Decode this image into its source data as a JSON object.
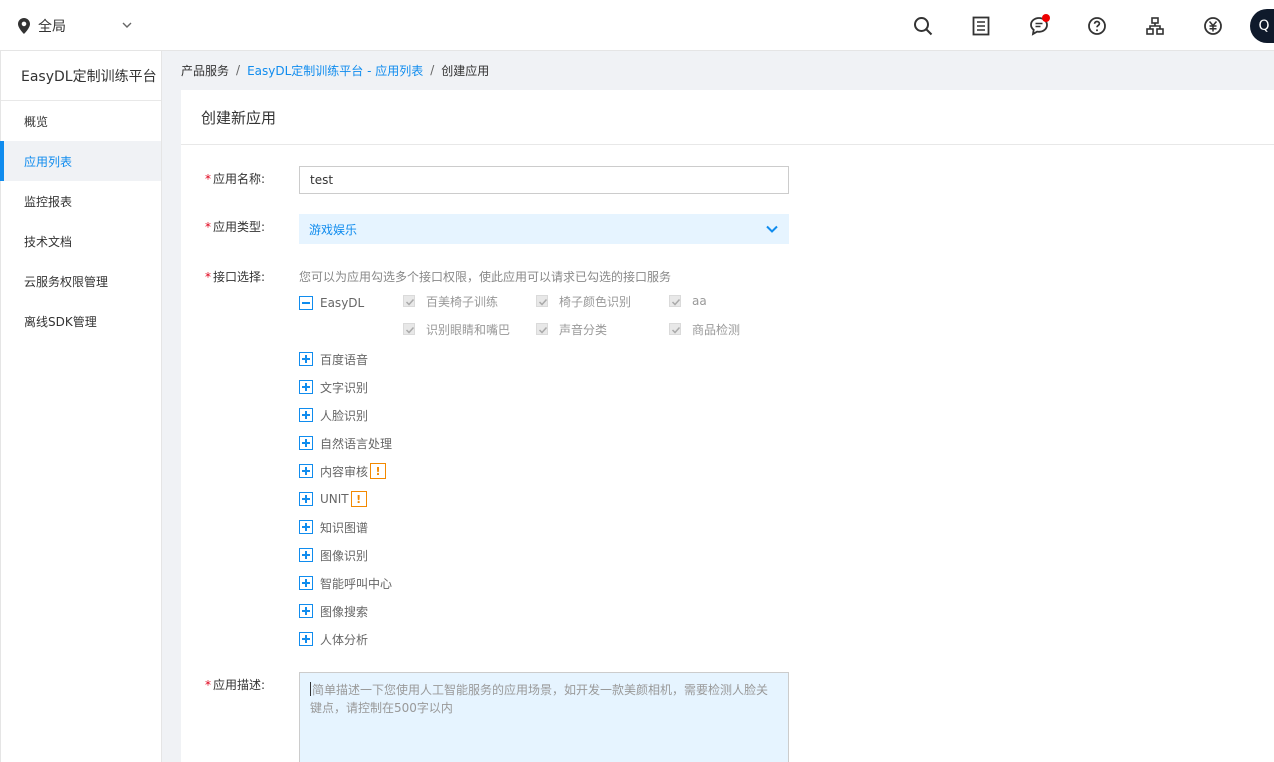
{
  "topbar": {
    "region_label": "全局",
    "avatar_letter": "Q"
  },
  "sidebar": {
    "brand": "EasyDL定制训练平台",
    "items": [
      {
        "label": "概览"
      },
      {
        "label": "应用列表"
      },
      {
        "label": "监控报表"
      },
      {
        "label": "技术文档"
      },
      {
        "label": "云服务权限管理"
      },
      {
        "label": "离线SDK管理"
      }
    ]
  },
  "breadcrumb": {
    "root": "产品服务",
    "parent": "EasyDL定制训练平台 - 应用列表",
    "current": "创建应用",
    "separator": "/"
  },
  "panel": {
    "title": "创建新应用"
  },
  "form": {
    "name_label": "应用名称:",
    "name_value": "test",
    "type_label": "应用类型:",
    "type_value": "游戏娱乐",
    "api_label": "接口选择:",
    "api_hint": "您可以为应用勾选多个接口权限，使此应用可以请求已勾选的接口服务",
    "easydl_group": "EasyDL",
    "easydl_items": [
      "百美椅子训练",
      "椅子颜色识别",
      "aa",
      "识别眼睛和嘴巴",
      "声音分类",
      "商品检测"
    ],
    "groups": [
      "百度语音",
      "文字识别",
      "人脸识别",
      "自然语言处理",
      "内容审核",
      "UNIT",
      "知识图谱",
      "图像识别",
      "智能呼叫中心",
      "图像搜索",
      "人体分析"
    ],
    "warn_mark": "!",
    "desc_label": "应用描述:",
    "desc_placeholder": "简单描述一下您使用人工智能服务的应用场景，如开发一款美颜相机，需要检测人脸关键点，请控制在500字以内",
    "required_mark": "*"
  },
  "colors": {
    "accent": "#108cee",
    "required": "#e0001a",
    "warning": "#f38900",
    "notification": "#ee0000"
  }
}
